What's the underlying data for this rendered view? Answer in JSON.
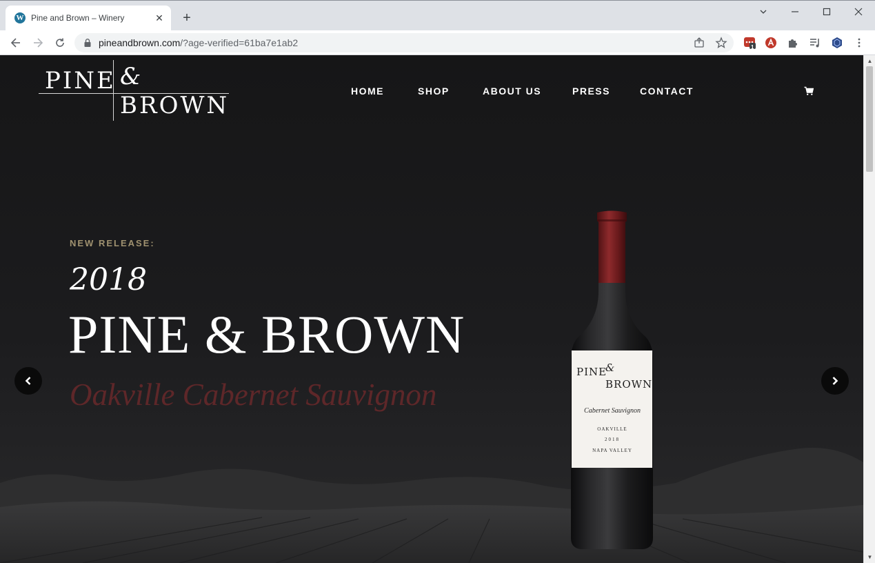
{
  "browser": {
    "tab": {
      "title": "Pine and Brown – Winery",
      "favicon": "wordpress-icon"
    },
    "url": {
      "host": "pineandbrown.com",
      "path": "/?age-verified=61ba7e1ab2"
    },
    "extensions": [
      "ublock-icon",
      "adblock-icon",
      "puzzle-icon",
      "media-queue-icon",
      "cube-extension-icon"
    ],
    "extension_badge": "1"
  },
  "site": {
    "logo": {
      "word1": "PINE",
      "amp": "&",
      "word2": "BROWN"
    },
    "nav": [
      {
        "label": "HOME"
      },
      {
        "label": "SHOP"
      },
      {
        "label": "ABOUT US"
      },
      {
        "label": "PRESS"
      },
      {
        "label": "CONTACT"
      }
    ],
    "cart_icon": "cart-icon"
  },
  "hero": {
    "eyebrow": "NEW RELEASE:",
    "year": "2018",
    "title": "PINE & BROWN",
    "subtitle": "Oakville Cabernet Sauvignon",
    "subtitle_color": "#5e2729",
    "eyebrow_color": "#a09270"
  },
  "bottle_label": {
    "pine": "PINE",
    "amp": "&",
    "brown": "BROWN",
    "varietal": "Cabernet Sauvignon",
    "region": "OAKVILLE",
    "vintage": "2018",
    "appellation": "NAPA VALLEY"
  }
}
